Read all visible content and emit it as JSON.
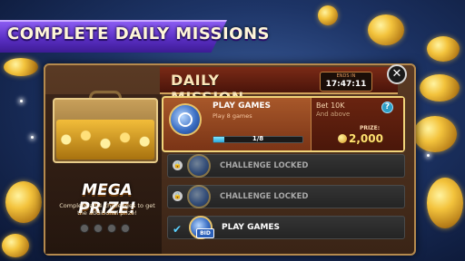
{
  "banner": {
    "title": "COMPLETE DAILY MISSIONS"
  },
  "panel": {
    "title": "DAILY MISSION",
    "timer": {
      "label": "ENDS IN",
      "value": "17:47:11"
    },
    "close_icon": "close-icon"
  },
  "mega_prize": {
    "title": "MEGA PRIZE!",
    "description": "Complete all 4 challenges to get the additional prize!",
    "dots_total": 4
  },
  "missions": [
    {
      "title": "PLAY GAMES",
      "subtitle": "Play 8 games",
      "progress_text": "1/8",
      "progress_value": 0.125,
      "bet_text": "Bet 10K",
      "bet_sub": "And above",
      "prize_label": "PRIZE:",
      "prize_value": "2,000",
      "info_icon": "?",
      "state": "active"
    },
    {
      "title": "CHALLENGE LOCKED",
      "state": "locked"
    },
    {
      "title": "CHALLENGE LOCKED",
      "state": "locked"
    },
    {
      "title": "PLAY GAMES",
      "badge": "BID",
      "state": "completed"
    }
  ],
  "icons": {
    "lock": "🔒",
    "check": "✔",
    "close": "✕"
  },
  "colors": {
    "accent_purple": "#5a2fc4",
    "panel_brown": "#3a2416",
    "gold": "#f3c33c",
    "progress_blue": "#2ba6d8"
  }
}
